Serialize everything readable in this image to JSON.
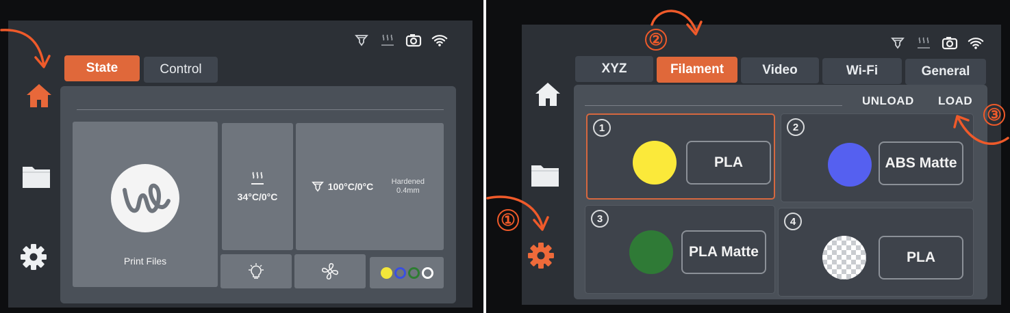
{
  "left_screen": {
    "tabs": [
      {
        "label": "State",
        "active": true
      },
      {
        "label": "Control",
        "active": false
      }
    ],
    "sidebar": [
      "home-icon",
      "folder-icon",
      "gear-icon"
    ],
    "active_sidebar": "home-icon",
    "print_files_label": "Print Files",
    "bed_temp": "34°C/0°C",
    "nozzle_temp": "100°C/0°C",
    "nozzle_type_line1": "Hardened",
    "nozzle_type_line2": "0.4mm",
    "quick_controls": [
      "light-icon",
      "fan-icon",
      "filament-slots-icon"
    ],
    "slot_colors": [
      "#f3e63a",
      "#3a4fe0",
      "#2e7d32",
      "#ffffff"
    ]
  },
  "right_screen": {
    "tabs": [
      {
        "label": "XYZ",
        "active": false
      },
      {
        "label": "Filament",
        "active": true
      },
      {
        "label": "Video",
        "active": false
      },
      {
        "label": "Wi-Fi",
        "active": false
      },
      {
        "label": "General",
        "active": false
      }
    ],
    "actions": {
      "unload": "UNLOAD",
      "load": "LOAD"
    },
    "slots": [
      {
        "num": "1",
        "color": "#fbe93a",
        "name": "PLA",
        "selected": true
      },
      {
        "num": "2",
        "color": "#5560f0",
        "name": "ABS Matte",
        "selected": false
      },
      {
        "num": "3",
        "color": "#2f7a36",
        "name": "PLA Matte",
        "selected": false
      },
      {
        "num": "4",
        "color": "checker",
        "name": "PLA",
        "selected": false
      }
    ],
    "active_sidebar": "gear-icon"
  },
  "annotations": [
    "①",
    "②",
    "③"
  ],
  "colors": {
    "accent": "#e0683a",
    "annotation": "#ef5a2a"
  }
}
